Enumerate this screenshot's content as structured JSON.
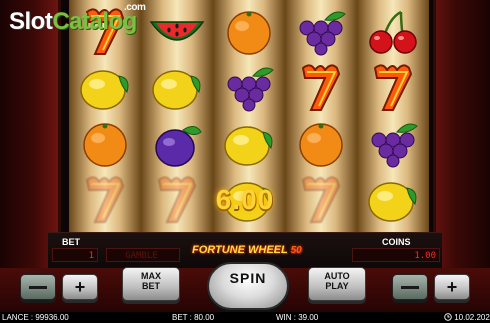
{
  "watermark": {
    "part1": "Slot",
    "part2": "Catalog",
    "suffix": ".com"
  },
  "reels": [
    [
      "flame-seven-icon",
      "lemon-icon",
      "orange-icon",
      "flame-seven-icon"
    ],
    [
      "watermelon-icon",
      "lemon-icon",
      "plum-icon",
      "flame-seven-icon"
    ],
    [
      "orange-icon",
      "grapes-icon",
      "lemon-icon",
      "lemon-icon"
    ],
    [
      "grapes-icon",
      "flame-seven-icon",
      "orange-icon",
      "flame-seven-icon"
    ],
    [
      "cherry-icon",
      "flame-seven-icon",
      "grapes-icon",
      "lemon-icon"
    ]
  ],
  "win_amount": "6.00",
  "panel": {
    "bet_label": "BET",
    "bet_value": "1",
    "gamble_label": "GAMBLE",
    "game_logo": "FORTUNE WHEEL",
    "game_logo_number": "50",
    "coins_label": "COINS",
    "coins_value": "1.00"
  },
  "buttons": {
    "max_bet": "MAX\nBET",
    "spin": "SPIN",
    "auto_play": "AUTO\nPLAY",
    "minus": "−",
    "plus": "+"
  },
  "status": {
    "balance_label": "LANCE :",
    "balance_value": "99936.00",
    "bet_label": "BET :",
    "bet_value": "80.00",
    "win_label": "WIN :",
    "win_value": "39.00",
    "clock": "10.02.202"
  },
  "colors": {
    "accent_gold": "#ffd23a",
    "led_red": "#ff2a1a",
    "cabinet_red": "#6e1410",
    "logo_green": "#7bc043"
  }
}
